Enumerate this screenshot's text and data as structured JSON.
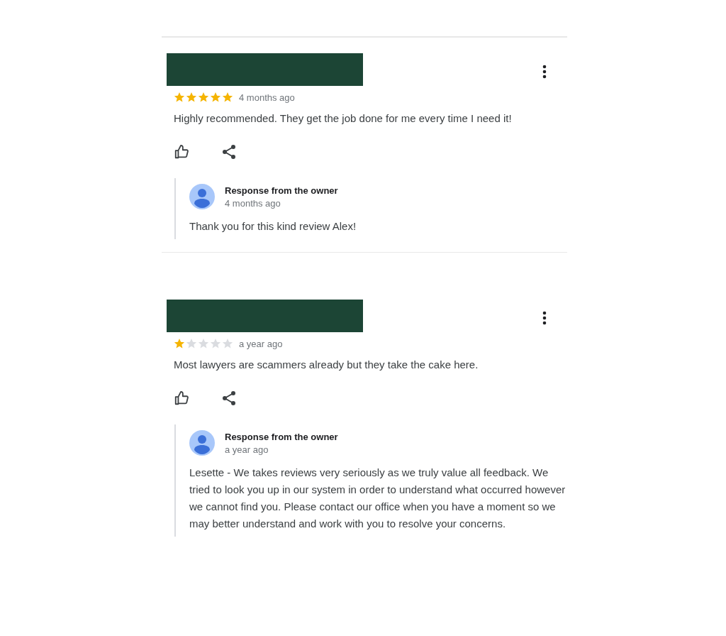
{
  "reviews": [
    {
      "stars": 5,
      "time": "4 months ago",
      "text": "Highly recommended. They get the job done for me every time I need it!",
      "response": {
        "title": "Response from the owner",
        "time": "4 months ago",
        "text": "Thank you for this kind review Alex!"
      }
    },
    {
      "stars": 1,
      "time": "a year ago",
      "text": "Most lawyers are scammers already but they take the cake here.",
      "response": {
        "title": "Response from the owner",
        "time": "a year ago",
        "text": "Lesette - We takes reviews very seriously as we truly value all feedback. We tried to look you up in our system in order to understand what occurred however we cannot find you. Please contact our office when you have a moment so we may better understand and work with you to resolve your concerns."
      }
    }
  ]
}
